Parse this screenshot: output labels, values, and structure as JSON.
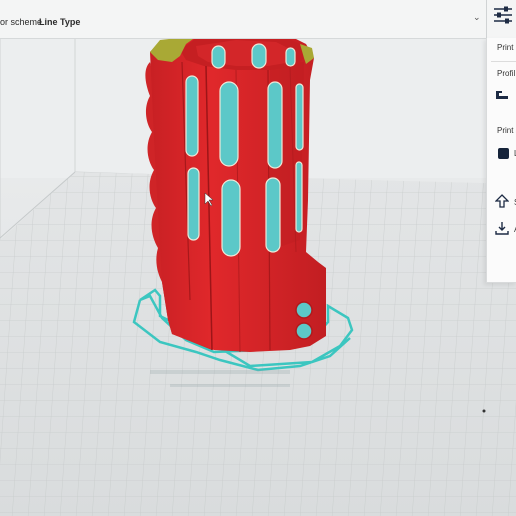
{
  "toolbar": {
    "color_scheme_label": "or scheme",
    "line_type_label": "Line Type",
    "dropdown_icon": "chevron-down-icon",
    "settings_icon": "sliders-icon"
  },
  "print_panel": {
    "title": "Print",
    "profile_label": "Profil",
    "print_settings_label": "Print s",
    "swatch_text": "L",
    "swatch_color": "#15233a",
    "slice_label": "S",
    "save_label": "A"
  },
  "colors": {
    "model_red": "#d9282b",
    "model_infill": "#a9a935",
    "model_cyan": "#5cc8c8",
    "skirt": "#3cc6c0",
    "grid_line": "#c7cbcd"
  }
}
